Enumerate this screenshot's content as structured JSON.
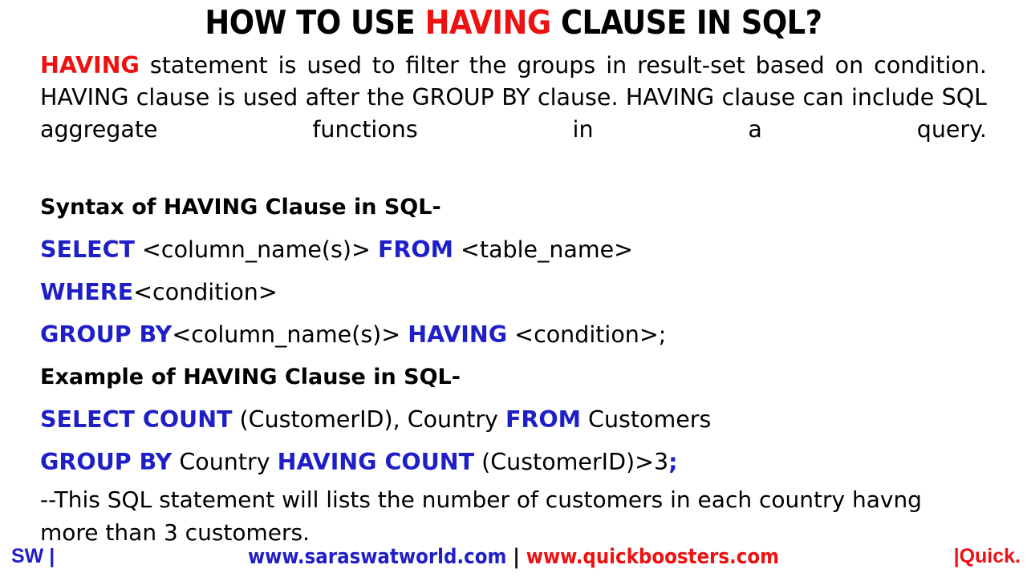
{
  "title": {
    "part1": "HOW TO USE ",
    "highlight": "HAVING",
    "part2": " CLAUSE IN SQL?"
  },
  "intro": {
    "keyword": "HAVING",
    "text": " statement is used to filter the groups in result-set based on condition. HAVING clause is used after the GROUP BY clause. HAVING clause can include SQL aggregate functions in a query."
  },
  "syntax_heading": "Syntax of HAVING Clause in SQL-",
  "syntax": {
    "line1": {
      "kw1": "SELECT",
      "t1": " <column_name(s)> ",
      "kw2": "FROM",
      "t2": " <table_name>"
    },
    "line2": {
      "kw1": "WHERE",
      "t1": "<condition>"
    },
    "line3": {
      "kw1": "GROUP BY",
      "t1": "<column_name(s)> ",
      "kw2": "HAVING",
      "t2": " <condition>;"
    }
  },
  "example_heading": "Example of HAVING Clause in SQL-",
  "example": {
    "line1": {
      "kw1": "SELECT COUNT",
      "t1": " (CustomerID), Country ",
      "kw2": "FROM",
      "t2": " Customers"
    },
    "line2": {
      "kw1": "GROUP BY",
      "t1": " Country ",
      "kw2": "HAVING COUNT",
      "t2": " (CustomerID)>3",
      "kw3": ";"
    }
  },
  "note": "--This SQL statement will lists the number of customers in each country havng more than 3 customers.",
  "footer": {
    "left": "SW |",
    "url1": "www.saraswatworld.com",
    "separator": " | ",
    "url2": "www.quickboosters.com",
    "right": "|Quick."
  },
  "colors": {
    "blue": "#1f1fc8",
    "red": "#ee1111",
    "black": "#000000",
    "background": "#ffffff"
  }
}
